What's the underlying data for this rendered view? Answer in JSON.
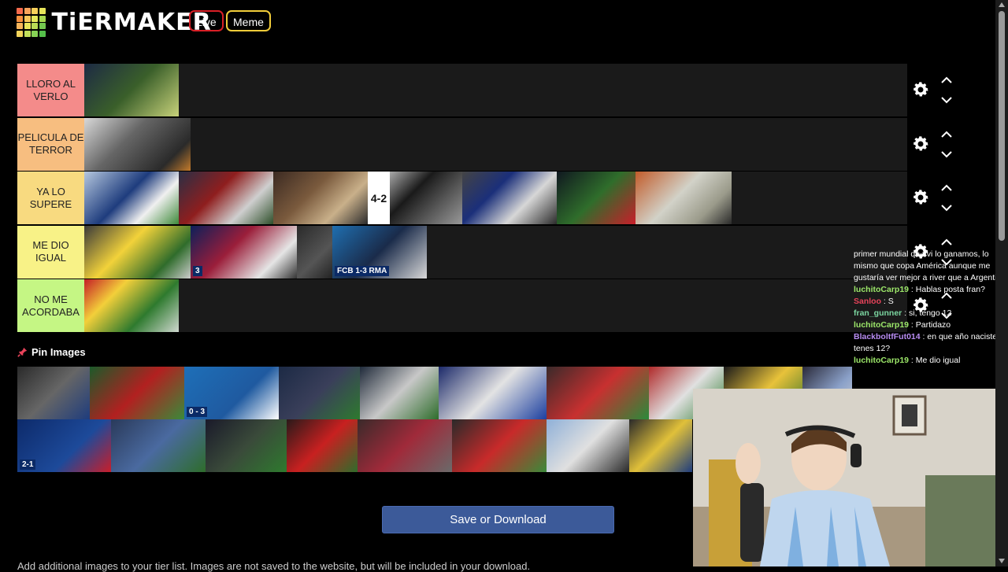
{
  "header": {
    "logo_text": "TiERMAKER",
    "live_label": "Live",
    "meme_label": "Meme",
    "logo_colors": [
      "#f56a4c",
      "#f7a35a",
      "#f7d05a",
      "#e6e45a",
      "#f5903e",
      "#f7c65a",
      "#e5e85a",
      "#a6d94f",
      "#f7b45a",
      "#e8e55a",
      "#b9db55",
      "#74c84f",
      "#f2d35a",
      "#c2df5a",
      "#86d255",
      "#55bf4a"
    ]
  },
  "tiers": [
    {
      "label": "LLORO AL VERLO",
      "color": "#f48b8a",
      "items": [
        {
          "w": 120,
          "bg": "linear-gradient(135deg,#1d2a44 0%,#3a5f2a 50%,#c8d27a 100%)"
        }
      ]
    },
    {
      "label": "PELICULA DE TERROR",
      "color": "#f7be80",
      "items": [
        {
          "w": 135,
          "bg": "linear-gradient(135deg,#d8d8d8 0%,#666 40%,#2a2a2a 80%,#c47b2b 100%)"
        }
      ]
    },
    {
      "label": "YA LO SUPERE",
      "color": "#f8da80",
      "items": [
        {
          "w": 120,
          "bg": "linear-gradient(135deg,#b5c7de 0%,#1e3c7d 45%,#f0f0f0 70%,#3e8a3a 100%)"
        },
        {
          "w": 120,
          "bg": "linear-gradient(135deg,#2a2f45 0%,#8f1e1e 40%,#cfcfcf 70%,#2e4f2a 100%)"
        },
        {
          "w": 120,
          "bg": "linear-gradient(135deg,#3b2a22 0%,#7a5a3d 40%,#c9b08a 70%,#2b2b2b 100%)"
        },
        {
          "w": 120,
          "bg": "linear-gradient(135deg,#f2f2f2 0%,#1a1a1a 45%,#555 70%,#999 100%)",
          "bigtag": "4-2"
        },
        {
          "w": 120,
          "bg": "linear-gradient(135deg,#444 0%,#1b2f7a 35%,#d7d7d7 65%,#2a2a2a 100%)"
        },
        {
          "w": 100,
          "bg": "linear-gradient(135deg,#101820 0%,#2f6d2b 50%,#c91e2a 100%)"
        },
        {
          "w": 122,
          "bg": "linear-gradient(135deg,#c25b2a 0%,#d2d2c8 45%,#9a9a8a 75%,#2a2a2a 100%)"
        }
      ]
    },
    {
      "label": "ME DIO IGUAL",
      "color": "#f8f287",
      "items": [
        {
          "w": 135,
          "bg": "linear-gradient(135deg,#3a3a3a 0%,#f2d23a 40%,#2f6c2b 75%,#ccc 100%)"
        },
        {
          "w": 135,
          "bg": "linear-gradient(135deg,#0d1f5a 0%,#9b1e3a 40%,#e5e5e5 75%,#333 100%)",
          "tag": "3"
        },
        {
          "w": 45,
          "bg": "linear-gradient(135deg,#2a2a2a 0%,#555 60%,#222 100%)"
        },
        {
          "w": 120,
          "bg": "linear-gradient(135deg,#1f6fb0 0%,#1a2b4a 50%,#d8d8d8 100%)",
          "tag": "FCB 1-3 RMA"
        }
      ]
    },
    {
      "label": "NO ME ACORDABA",
      "color": "#c5f684",
      "items": [
        {
          "w": 120,
          "bg": "linear-gradient(135deg,#c41e26 0%,#f3cf3a 30%,#2e7a2e 65%,#cfd8cf 100%)"
        }
      ]
    }
  ],
  "pin": {
    "label": "Pin Images"
  },
  "pool_rows": [
    [
      {
        "w": 92,
        "bg": "linear-gradient(135deg,#2a2a2a,#666,#1e3c7d)"
      },
      {
        "w": 120,
        "bg": "linear-gradient(135deg,#1c5a2a,#b22020,#3a8a3a)"
      },
      {
        "w": 120,
        "bg": "linear-gradient(135deg,#1e6fb8 0%,#1f5aa0 60%,#ffffff 100%)",
        "tag": "0 - 3"
      },
      {
        "w": 103,
        "bg": "linear-gradient(135deg,#1c2a45,#3a3f5a,#2e7a2e)"
      },
      {
        "w": 100,
        "bg": "linear-gradient(135deg,#1f2a3a,#c8c8c8,#2e6d2b)"
      },
      {
        "w": 137,
        "bg": "linear-gradient(135deg,#1c2a6a,#e3e3e3,#1c3fa0)"
      },
      {
        "w": 130,
        "bg": "linear-gradient(135deg,#3a2a2a,#c83030,#2a8a3a)"
      },
      {
        "w": 95,
        "bg": "linear-gradient(135deg,#b02a2a,#e0e0e0,#2e7a2e)"
      },
      {
        "w": 100,
        "bg": "linear-gradient(135deg,#1a1a1a,#e8c23a,#2e6d2b)"
      },
      {
        "w": 75,
        "bg": "linear-gradient(135deg,#2a2a3a,#8aa0c8,#e0e0e0)"
      },
      {
        "w": 70,
        "bg": "linear-gradient(135deg,#3a3a3a,#b04040,#2e6d2b)"
      }
    ],
    [
      {
        "w": 119,
        "bg": "linear-gradient(135deg,#0d2a6a 0%,#1d4a9a 60%,#c81e2a 100%)",
        "tag": "2-1"
      },
      {
        "w": 120,
        "bg": "linear-gradient(135deg,#2a3a5a,#4a6aa0,#2e6d2b)"
      },
      {
        "w": 103,
        "bg": "linear-gradient(135deg,#1a1a2a,#3a4a3a,#2e7a2e)"
      },
      {
        "w": 90,
        "bg": "linear-gradient(135deg,#2a1a1a,#c82020,#2e6d2b)"
      },
      {
        "w": 120,
        "bg": "linear-gradient(135deg,#3a2a2a,#a02a3a,#6a6a6a)"
      },
      {
        "w": 120,
        "bg": "linear-gradient(135deg,#2a2a2a,#c82a2a,#3a8a3a)"
      },
      {
        "w": 105,
        "bg": "linear-gradient(135deg,#8fb0d8,#e0e0e0,#2a2a2a)"
      },
      {
        "w": 80,
        "bg": "linear-gradient(135deg,#2a2a2a,#e0c03a,#1e3c7d)"
      }
    ]
  ],
  "chat": [
    {
      "user": "",
      "msg": "primer mundial que vi lo ganamos, lo mismo que copa América aunque me gustaría ver mejor a river que a Argentina",
      "color": "#ffffff"
    },
    {
      "user": "luchitoCarp19",
      "msg": "Hablas posta fran?",
      "color": "#9de86a"
    },
    {
      "user": "Sanloo",
      "msg": "S",
      "color": "#e8435a"
    },
    {
      "user": "fran_gunner",
      "msg": "si, tengo 12",
      "color": "#7bd5a0"
    },
    {
      "user": "luchitoCarp19",
      "msg": "Partidazo",
      "color": "#9de86a"
    },
    {
      "user": "BlackboltfFut014",
      "msg": "en que año naciste si tenes 12?",
      "color": "#b88cf2"
    },
    {
      "user": "luchitoCarp19",
      "msg": "Me dio igual",
      "color": "#9de86a"
    }
  ],
  "save_button": {
    "label": "Save or Download"
  },
  "footer": {
    "text": "Add additional images to your tier list. Images are not saved to the website, but will be included in your download."
  }
}
